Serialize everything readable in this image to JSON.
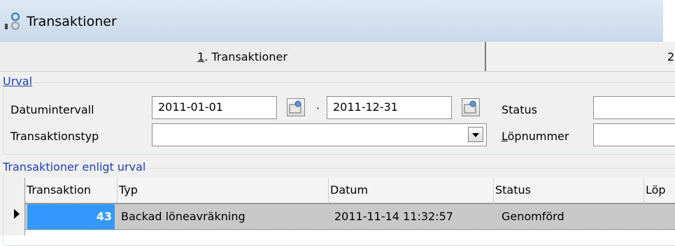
{
  "window": {
    "title": "Transaktioner"
  },
  "tabs": [
    {
      "label": "1. Transaktioner",
      "hotkey": "1",
      "rest": ". Transaktioner"
    },
    {
      "label": "2"
    }
  ],
  "filter": {
    "title": "Urval",
    "date_label": "Datumintervall",
    "date_from": "2011-01-01",
    "date_separator": "·",
    "date_to": "2011-12-31",
    "status_label": "Status",
    "status_value": "",
    "type_label": "Transaktionstyp",
    "type_value": "",
    "serial_label": "Löpnummer",
    "serial_hotkey": "L",
    "serial_rest": "öpnummer",
    "serial_value": ""
  },
  "results": {
    "title": "Transaktioner enligt urval",
    "columns": [
      "Transaktion",
      "Typ",
      "Datum",
      "Status",
      "Löp"
    ],
    "rows": [
      {
        "transaktion": "43",
        "typ": "Backad löneavräkning",
        "datum": "2011-11-14 11:32:57",
        "status": "Genomförd",
        "lop": ""
      }
    ]
  },
  "colors": {
    "group_title": "#1b3fbb",
    "selected_row": "#c8c8c8",
    "selected_cell": "#3399ff"
  }
}
